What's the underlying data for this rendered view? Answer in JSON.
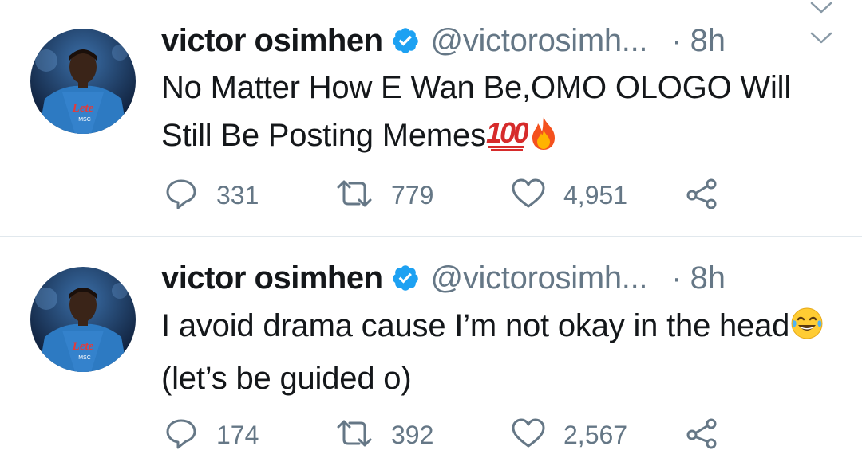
{
  "tweets": [
    {
      "author_name": "victor osimhen",
      "handle": "@victorosimh...",
      "separator": "·",
      "time": "8h",
      "text_main": "No Matter How E Wan Be,OMO OLOGO Will Still Be Posting Memes",
      "text_suffix": "",
      "emojis": [
        "hundred-points",
        "fire"
      ],
      "replies": "331",
      "retweets": "779",
      "likes": "4,951"
    },
    {
      "author_name": "victor osimhen",
      "handle": "@victorosimh...",
      "separator": "·",
      "time": "8h",
      "text_main": "I avoid drama cause I’m not okay in the head",
      "text_suffix": " (let’s be guided o)",
      "emojis": [
        "tears-of-joy"
      ],
      "replies": "174",
      "retweets": "392",
      "likes": "2,567"
    }
  ],
  "avatar_text": [
    "Lete",
    "MSC"
  ],
  "colors": {
    "text": "#14171a",
    "secondary": "#657786",
    "verified": "#1da1f2",
    "divider": "#e1e8ed",
    "jersey": "#2d7ac2"
  },
  "icons": [
    "reply-icon",
    "retweet-icon",
    "like-icon",
    "share-icon",
    "verified-badge-icon",
    "chevron-down-icon"
  ]
}
